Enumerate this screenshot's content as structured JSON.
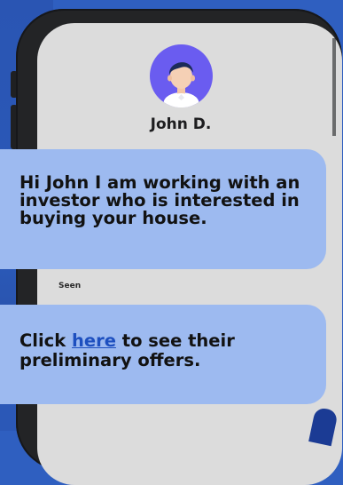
{
  "contact": {
    "name": "John D."
  },
  "messages": [
    {
      "text": "Hi John I am working with an investor who is interested in buying your house."
    },
    {
      "before_link": "Click ",
      "link_text": "here",
      "after_link": " to see their preliminary offers."
    }
  ],
  "status": {
    "seen_label": "Seen"
  },
  "colors": {
    "background": "#2f5fc0",
    "phone_frame": "#232426",
    "screen": "#dcdcdc",
    "bubble": "#9dbaf0",
    "avatar_bg": "#6a5cf0",
    "link": "#1d4fbf"
  },
  "icons": {
    "avatar": "user-avatar-icon"
  }
}
